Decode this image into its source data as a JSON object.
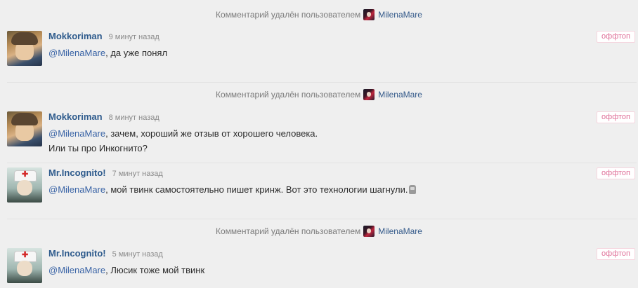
{
  "deleted_notice": {
    "text": "Комментарий удалён пользователем",
    "user": "MilenaMare"
  },
  "offtopic_label": "оффтоп",
  "comments": [
    {
      "author": "Mokkoriman",
      "time": "9 минут назад",
      "mention": "@MilenaMare",
      "lines": [
        ", да уже понял"
      ]
    },
    {
      "author": "Mokkoriman",
      "time": "8 минут назад",
      "mention": "@MilenaMare",
      "lines": [
        ", зачем, хороший же отзыв от хорошего человека.",
        "Или ты про Инкогнито?"
      ]
    },
    {
      "author": "Mr.Incognito!",
      "time": "7 минут назад",
      "mention": "@MilenaMare",
      "lines": [
        ", мой твинк самостоятельно пишет кринж. Вот это технологии шагнули."
      ]
    },
    {
      "author": "Mr.Incognito!",
      "time": "5 минут назад",
      "mention": "@MilenaMare",
      "lines": [
        ", Люсик тоже мой твинк"
      ]
    }
  ]
}
